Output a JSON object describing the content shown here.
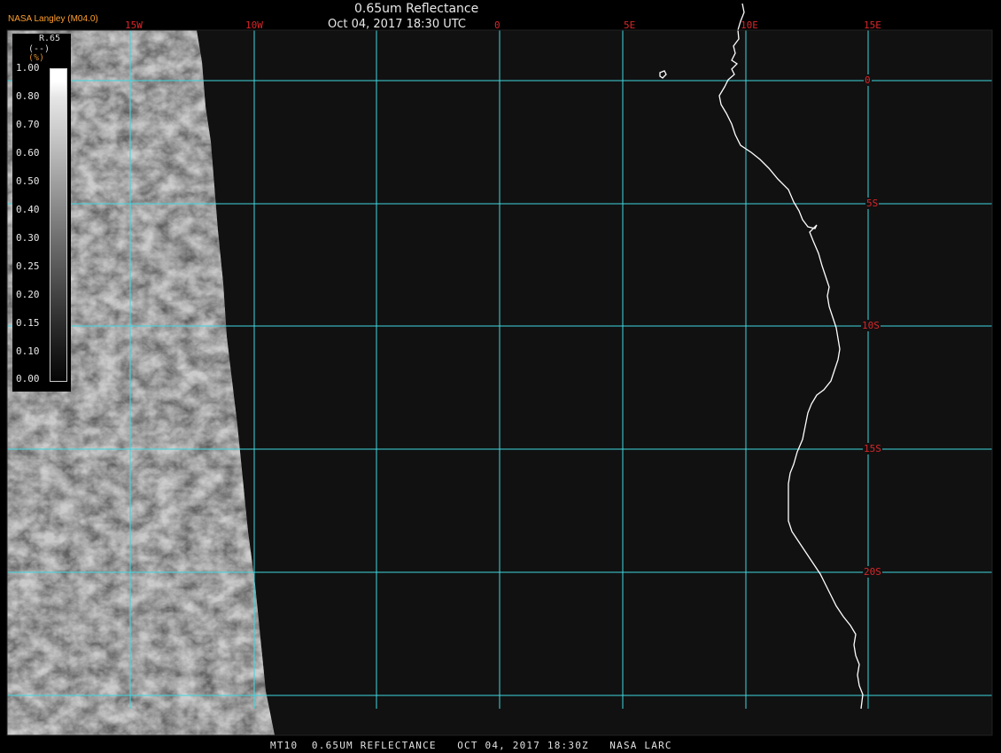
{
  "header": {
    "title": "0.65um Reflectance",
    "datetime": "Oct 04, 2017 18:30 UTC",
    "credit": "NASA Langley (M04.0)"
  },
  "footer": {
    "text": "MT10  0.65UM REFLECTANCE   OCT 04, 2017 18:30Z   NASA LARC"
  },
  "colorbar": {
    "title": "R.65",
    "units": "(--)",
    "units_prefix": "(%)",
    "ticks": [
      "1.00",
      "0.80",
      "0.70",
      "0.60",
      "0.50",
      "0.40",
      "0.30",
      "0.25",
      "0.20",
      "0.15",
      "0.10",
      "0.00"
    ]
  },
  "grid": {
    "longitude_labels": [
      "15W",
      "10W",
      "0",
      "5E",
      "10E",
      "15E"
    ],
    "latitude_labels": [
      "0",
      "5S",
      "10S",
      "15S",
      "20S"
    ],
    "line_color": "#3fd7e0",
    "label_color": "#d8262a"
  },
  "map": {
    "coastline_color": "#ffffff",
    "ocean_color": "#111111"
  }
}
